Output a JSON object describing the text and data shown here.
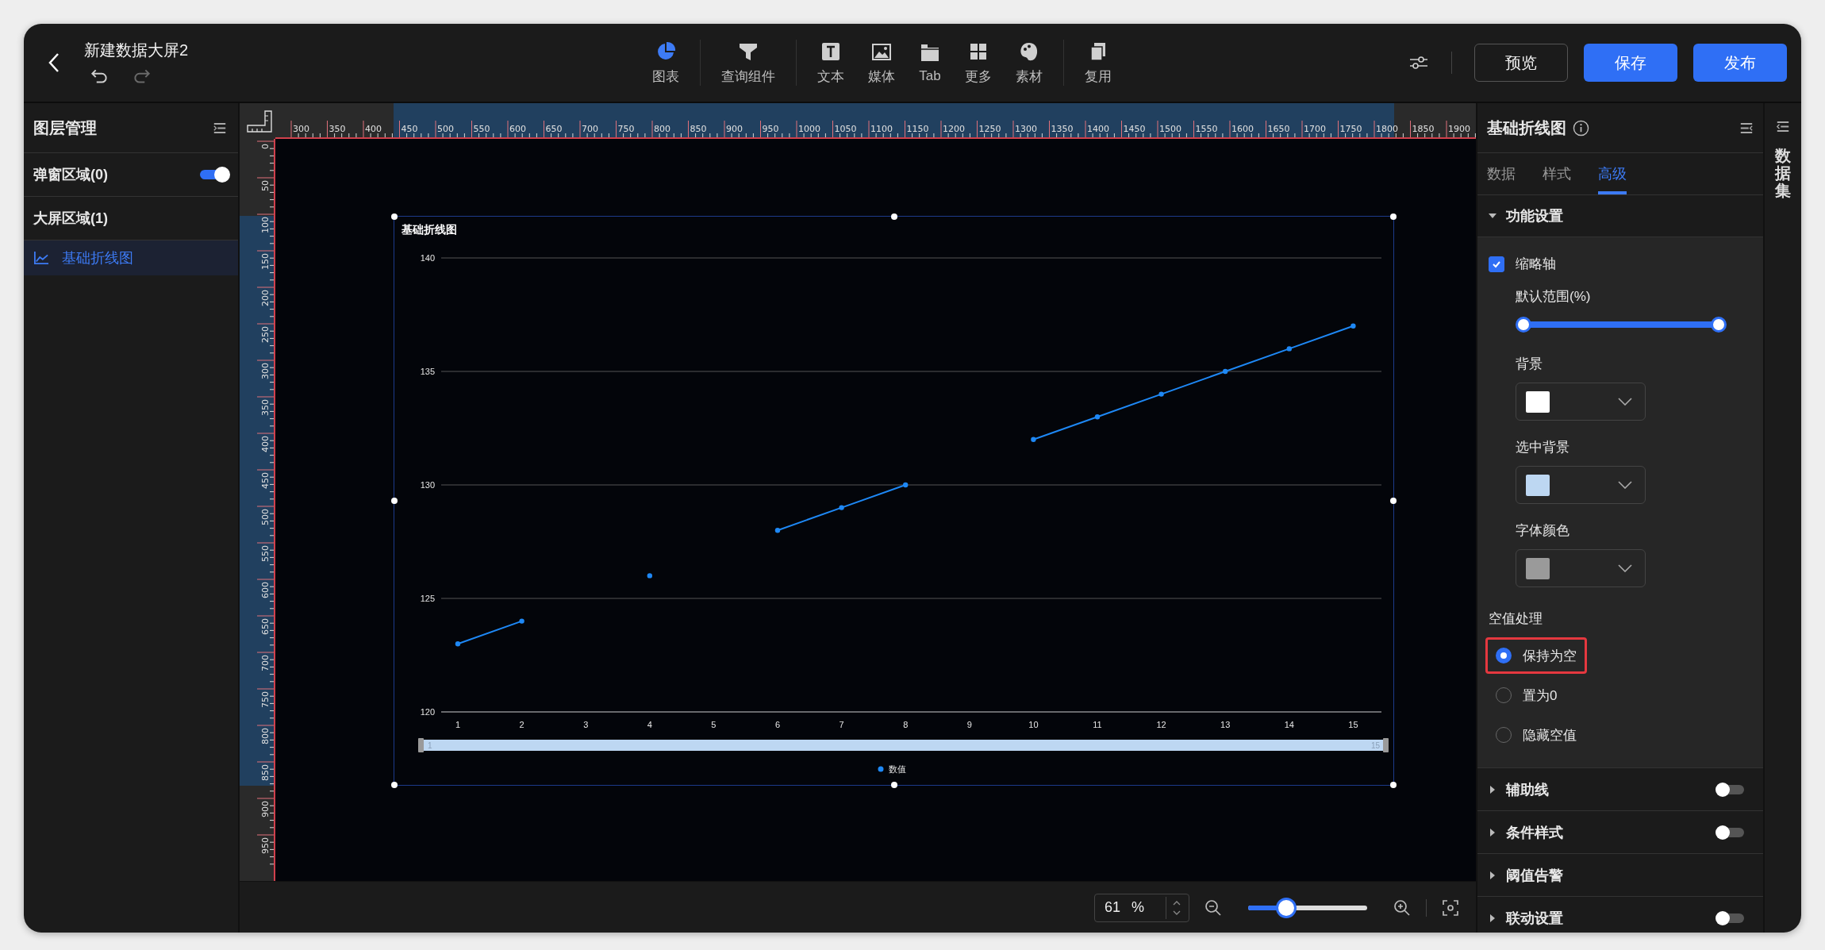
{
  "window": {
    "title": "新建数据大屏2"
  },
  "toolbar": [
    {
      "label": "图表",
      "kind": "chart",
      "selected": true,
      "separator": true
    },
    {
      "label": "查询组件",
      "kind": "filter",
      "selected": false,
      "separator": true
    },
    {
      "label": "文本",
      "kind": "text",
      "selected": false,
      "separator": false
    },
    {
      "label": "媒体",
      "kind": "media",
      "selected": false,
      "separator": false
    },
    {
      "label": "Tab",
      "kind": "tab",
      "selected": false,
      "separator": false
    },
    {
      "label": "更多",
      "kind": "more",
      "selected": false,
      "separator": false
    },
    {
      "label": "素材",
      "kind": "material",
      "selected": false,
      "separator": true
    },
    {
      "label": "复用",
      "kind": "reuse",
      "selected": false,
      "separator": false
    }
  ],
  "actions": [
    {
      "label": "预览",
      "kind": "secondary"
    },
    {
      "label": "保存",
      "kind": "primary"
    },
    {
      "label": "发布",
      "kind": "primary"
    }
  ],
  "layers_panel": {
    "title": "图层管理",
    "popup_area": {
      "label": "弹窗区域(0)",
      "on": true
    },
    "screen_area": {
      "label": "大屏区域(1)",
      "layers": [
        {
          "label": "基础折线图",
          "selected": true
        }
      ]
    }
  },
  "rulers": {
    "horizontal": [
      "300",
      "350",
      "400",
      "450",
      "500",
      "550",
      "600",
      "650",
      "700",
      "750",
      "800",
      "850",
      "900",
      "950",
      "1000",
      "1050",
      "1100",
      "1150",
      "1200",
      "1250",
      "1300",
      "1350",
      "1400",
      "1450",
      "1500",
      "1550",
      "1600",
      "1650",
      "1700",
      "1750",
      "1800",
      "1850",
      "1900"
    ],
    "vertical": [
      "0",
      "50",
      "100",
      "150",
      "200",
      "250",
      "300",
      "350",
      "400",
      "450",
      "500",
      "550",
      "600",
      "650",
      "700",
      "750",
      "800",
      "850",
      "900",
      "950"
    ]
  },
  "chart": {
    "chart_data": {
      "type": "line",
      "title": "基础折线图",
      "categories": [
        "1",
        "2",
        "3",
        "4",
        "5",
        "6",
        "7",
        "8",
        "9",
        "10",
        "11",
        "12",
        "13",
        "14",
        "15"
      ],
      "series": [
        {
          "name": "数值",
          "color": "#1e88f5",
          "marker": true,
          "values": [
            123,
            124,
            null,
            126,
            null,
            128,
            129,
            130,
            null,
            132,
            133,
            134,
            135,
            136,
            137
          ]
        }
      ],
      "ylim": [
        120,
        140
      ],
      "yticks": [
        120,
        125,
        130,
        135,
        140
      ],
      "grid": true
    },
    "zoom_labels": [
      "1",
      "15"
    ]
  },
  "zoom_bar": {
    "value": "61",
    "unit": "%",
    "level": 0.27
  },
  "properties": {
    "title": "基础折线图",
    "tabs": [
      {
        "label": "数据",
        "selected": false
      },
      {
        "label": "样式",
        "selected": false
      },
      {
        "label": "高级",
        "selected": true
      }
    ],
    "feature": {
      "label": "功能设置",
      "expanded": true,
      "thumbnail_axis": {
        "label": "缩略轴",
        "checked": true
      },
      "range": {
        "label": "默认范围(%)",
        "handles": [
          {
            "level": 0
          },
          {
            "level": 1
          }
        ]
      },
      "colors": [
        {
          "label": "背景",
          "color": "#ffffff"
        },
        {
          "label": "选中背景",
          "color": "#bdd7f2"
        },
        {
          "label": "字体颜色",
          "color": "#9a9a9a"
        }
      ],
      "null_handling": {
        "label": "空值处理",
        "options": [
          {
            "label": "保持为空",
            "selected": true,
            "highlighted": true
          },
          {
            "label": "置为0",
            "selected": false,
            "highlighted": false
          },
          {
            "label": "隐藏空值",
            "selected": false,
            "highlighted": false
          }
        ]
      }
    },
    "sections": [
      {
        "label": "辅助线",
        "expanded": false,
        "kind": "toggle",
        "on": false
      },
      {
        "label": "条件样式",
        "expanded": false,
        "kind": "toggle",
        "on": false
      },
      {
        "label": "阈值告警",
        "expanded": false,
        "kind": "plain"
      },
      {
        "label": "联动设置",
        "expanded": false,
        "kind": "toggle",
        "on": false
      }
    ]
  },
  "side_strip": {
    "label": "数据集"
  }
}
